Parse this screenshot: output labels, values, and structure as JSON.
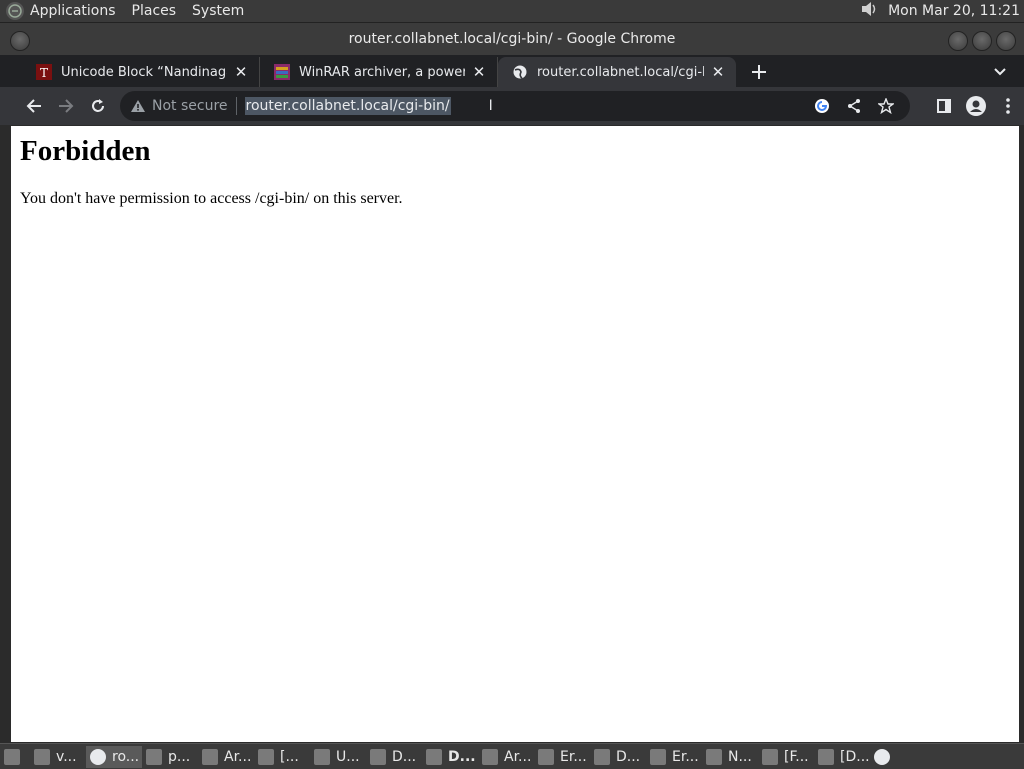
{
  "system": {
    "menus": [
      "Applications",
      "Places",
      "System"
    ],
    "clock": "Mon Mar 20, 11:21",
    "volume_icon": "speaker-icon"
  },
  "window": {
    "title": "router.collabnet.local/cgi-bin/ - Google Chrome"
  },
  "tabs": [
    {
      "title": "Unicode Block “Nandinagari”",
      "icon": "unicode-favicon",
      "active": false
    },
    {
      "title": "WinRAR archiver, a powerful t",
      "icon": "winrar-favicon",
      "active": false
    },
    {
      "title": "router.collabnet.local/cgi-bin/",
      "icon": "globe-icon",
      "active": true
    }
  ],
  "omnibox": {
    "security_label": "Not secure",
    "url": "router.collabnet.local/cgi-bin/"
  },
  "page": {
    "heading": "Forbidden",
    "message": "You don't have permission to access /cgi-bin/ on this server."
  },
  "taskbar": [
    {
      "label": "v...",
      "active": false
    },
    {
      "label": "ro...",
      "active": true
    },
    {
      "label": "p...",
      "active": false
    },
    {
      "label": "Ar...",
      "active": false
    },
    {
      "label": "[...",
      "active": false
    },
    {
      "label": "U...",
      "active": false
    },
    {
      "label": "D...",
      "active": false
    },
    {
      "label": "D...",
      "active": false,
      "bold": true
    },
    {
      "label": "Ar...",
      "active": false
    },
    {
      "label": "Er...",
      "active": false
    },
    {
      "label": "D...",
      "active": false
    },
    {
      "label": "Er...",
      "active": false
    },
    {
      "label": "N...",
      "active": false
    },
    {
      "label": "[F...",
      "active": false
    },
    {
      "label": "[D...",
      "active": false
    }
  ],
  "colors": {
    "chrome_dark": "#202124",
    "toolbar": "#35363a",
    "url_highlight": "#4d5764"
  }
}
